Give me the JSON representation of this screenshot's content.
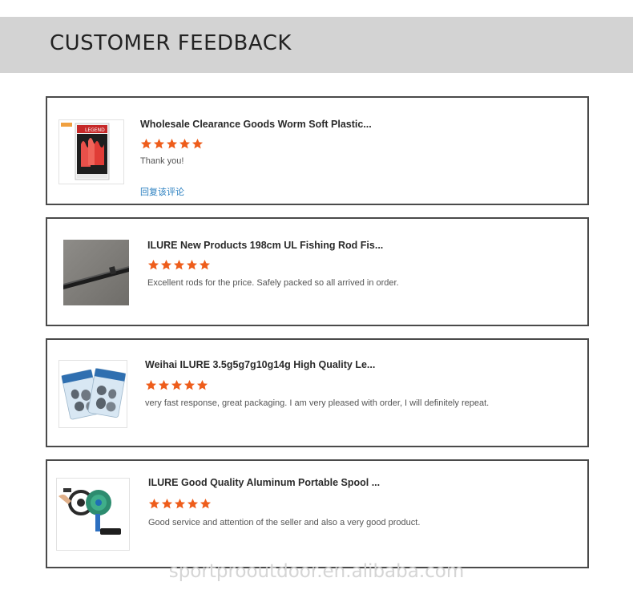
{
  "header": {
    "title": "CUSTOMER FEEDBACK"
  },
  "colors": {
    "star": "#ee5d1b",
    "header_bg": "#d3d3d3",
    "reply_link": "#2a7fc0"
  },
  "reviews": [
    {
      "product_title": "Wholesale Clearance Goods Worm Soft Plastic...",
      "rating": 5,
      "comment": "Thank you!",
      "reply_label": "回复该评论",
      "thumb_icon": "soft-worm-lure-pack-image",
      "thumb_brand": "LEGEND"
    },
    {
      "product_title": "ILURE New Products 198cm UL Fishing Rod Fis...",
      "rating": 5,
      "comment": "Excellent rods for the price. Safely packed so all arrived in order.",
      "thumb_icon": "fishing-rod-image"
    },
    {
      "product_title": "Weihai ILURE 3.5g5g7g10g14g High Quality Le...",
      "rating": 5,
      "comment": "very fast response, great packaging. I am very pleased with order, I will definitely repeat.",
      "thumb_icon": "lead-weights-pack-image"
    },
    {
      "product_title": "ILURE Good Quality Aluminum Portable Spool ...",
      "rating": 5,
      "comment": "Good service and attention of the seller and also a very good product.",
      "thumb_icon": "spool-tool-image"
    }
  ],
  "watermark": "sportprooutdoor.en.alibaba.com"
}
